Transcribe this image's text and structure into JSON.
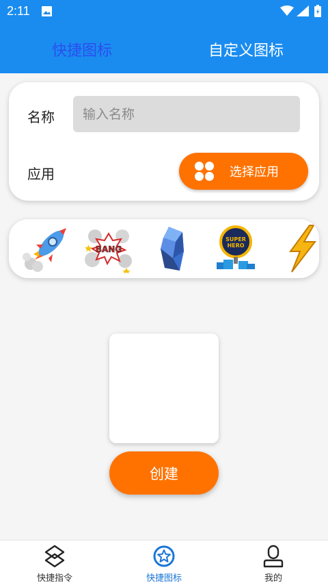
{
  "status_bar": {
    "time": "2:11"
  },
  "header": {
    "tabs": [
      {
        "label": "快捷图标",
        "active": true
      },
      {
        "label": "自定义图标",
        "active": false
      }
    ]
  },
  "form": {
    "name_label": "名称",
    "name_placeholder": "输入名称",
    "name_value": "",
    "app_label": "应用",
    "choose_app_button": "选择应用"
  },
  "icon_options": [
    {
      "icon": "rocket-sticker"
    },
    {
      "icon": "bang-comic-sticker"
    },
    {
      "icon": "blue-crystal-sticker"
    },
    {
      "icon": "super-hero-badge-sticker"
    },
    {
      "icon": "lightning-bolt-sticker"
    }
  ],
  "create_button": "创建",
  "bottom_nav": [
    {
      "label": "快捷指令",
      "icon": "shortcut-icon",
      "active": false
    },
    {
      "label": "快捷图标",
      "icon": "star-badge-icon",
      "active": true
    },
    {
      "label": "我的",
      "icon": "profile-icon",
      "active": false
    }
  ],
  "colors": {
    "primary": "#1a8cf0",
    "active_tab": "#2b4ef0",
    "accent": "#ff7200",
    "nav_active": "#1a75d6"
  }
}
